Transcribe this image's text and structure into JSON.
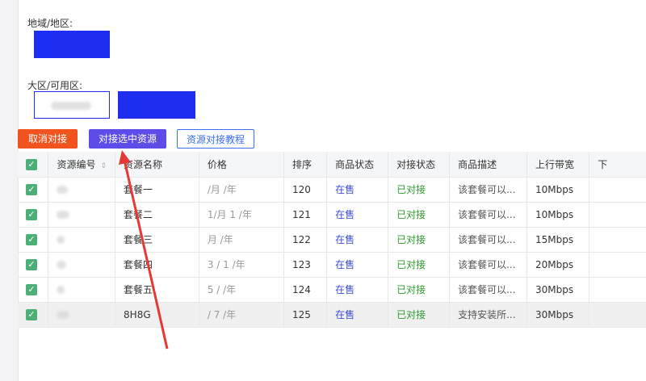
{
  "region_label": "地域/地区:",
  "zone_label": "大区/可用区:",
  "buttons": {
    "cancel": "取消对接",
    "connect_selected": "对接选中资源",
    "tutorial": "资源对接教程"
  },
  "colors": {
    "redacted_blue": "#1e2ef0",
    "cancel_bg": "#f0531e",
    "connect_bg": "#5d4ce8",
    "tutorial_border": "#3b6ef0",
    "annotation_arrow": "#e53935",
    "on_sale": "#3b4cd6",
    "linked": "#2e9b2e",
    "checkbox": "#4caf78"
  },
  "table": {
    "headers": [
      "",
      "资源编号",
      "资源名称",
      "价格",
      "排序",
      "商品状态",
      "对接状态",
      "商品描述",
      "上行带宽",
      "下"
    ],
    "rows": [
      {
        "name": "套餐一",
        "price": "/月 /年",
        "order": "120",
        "status": "在售",
        "link": "已对接",
        "desc": "该套餐可以...",
        "bw": "10Mbps"
      },
      {
        "name": "套餐二",
        "price": "1/月 1 /年",
        "order": "121",
        "status": "在售",
        "link": "已对接",
        "desc": "该套餐可以...",
        "bw": "10Mbps"
      },
      {
        "name": "套餐三",
        "price": "月 /年",
        "order": "122",
        "status": "在售",
        "link": "已对接",
        "desc": "该套餐可以...",
        "bw": "15Mbps"
      },
      {
        "name": "套餐四",
        "price": "3 / 1 /年",
        "order": "123",
        "status": "在售",
        "link": "已对接",
        "desc": "该套餐可以...",
        "bw": "20Mbps"
      },
      {
        "name": "套餐五",
        "price": "5 / /年",
        "order": "124",
        "status": "在售",
        "link": "已对接",
        "desc": "该套餐可以...",
        "bw": "30Mbps"
      },
      {
        "name": "8H8G",
        "price": "/ 7 /年",
        "order": "125",
        "status": "在售",
        "link": "已对接",
        "desc": "支持安装所...",
        "bw": "30Mbps"
      }
    ]
  }
}
